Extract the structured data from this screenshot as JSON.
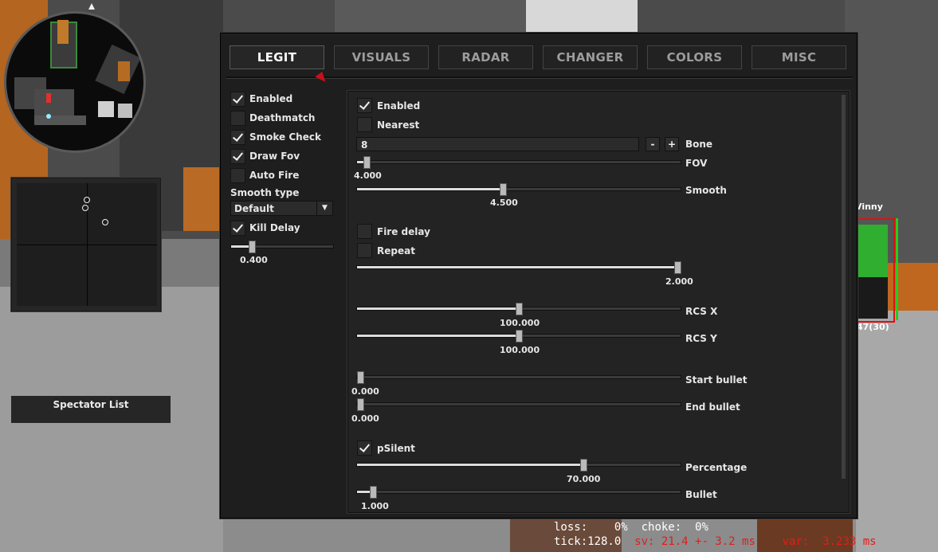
{
  "menu": {
    "tabs": [
      {
        "label": "LEGIT",
        "active": true
      },
      {
        "label": "VISUALS",
        "active": false
      },
      {
        "label": "RADAR",
        "active": false
      },
      {
        "label": "CHANGER",
        "active": false
      },
      {
        "label": "COLORS",
        "active": false
      },
      {
        "label": "MISC",
        "active": false
      }
    ],
    "left": {
      "enabled": {
        "label": "Enabled",
        "checked": true
      },
      "deathmatch": {
        "label": "Deathmatch",
        "checked": false
      },
      "smoke_check": {
        "label": "Smoke Check",
        "checked": true
      },
      "draw_fov": {
        "label": "Draw Fov",
        "checked": true
      },
      "auto_fire": {
        "label": "Auto Fire",
        "checked": false
      },
      "smooth_type": {
        "label": "Smooth type",
        "value": "Default"
      },
      "kill_delay": {
        "label": "Kill Delay",
        "checked": true
      },
      "kill_delay_slider": {
        "value_text": "0.400",
        "fraction": 0.2
      }
    },
    "right": {
      "enabled": {
        "label": "Enabled",
        "checked": true
      },
      "nearest": {
        "label": "Nearest",
        "checked": false
      },
      "bone": {
        "label": "Bone",
        "value": "8",
        "minus": "-",
        "plus": "+"
      },
      "fov": {
        "label": "FOV",
        "value_text": "4.000",
        "fraction": 0.03
      },
      "smooth": {
        "label": "Smooth",
        "value_text": "4.500",
        "fraction": 0.45
      },
      "fire_delay": {
        "label": "Fire delay",
        "checked": false
      },
      "repeat": {
        "label": "Repeat",
        "checked": false
      },
      "repeat_slider": {
        "value_text": "2.000",
        "fraction": 1.0
      },
      "rcs_x": {
        "label": "RCS X",
        "value_text": "100.000",
        "fraction": 0.5
      },
      "rcs_y": {
        "label": "RCS Y",
        "value_text": "100.000",
        "fraction": 0.5
      },
      "start_bullet": {
        "label": "Start bullet",
        "value_text": "0.000",
        "fraction": 0.0
      },
      "end_bullet": {
        "label": "End bullet",
        "value_text": "0.000",
        "fraction": 0.0
      },
      "psilent": {
        "label": "pSilent",
        "checked": true
      },
      "percentage": {
        "label": "Percentage",
        "value_text": "70.000",
        "fraction": 0.7
      },
      "bullet": {
        "label": "Bullet",
        "value_text": "1.000",
        "fraction": 0.05
      }
    }
  },
  "spectator_list": {
    "title": "Spectator List"
  },
  "esp": {
    "name": "Vinny",
    "ammo": "47(30)"
  },
  "netgraph": {
    "loss_label": "loss:",
    "loss_value": "0%",
    "choke_label": "choke:",
    "choke_value": "0%",
    "tick": "tick:128.0",
    "sv": "sv: 21.4 +- 3.2 ms",
    "var": "var:  3.233 ms"
  },
  "colors": {
    "accent_red": "#e01010",
    "health_green": "#20d020",
    "menu_bg": "#1e1e1e"
  }
}
